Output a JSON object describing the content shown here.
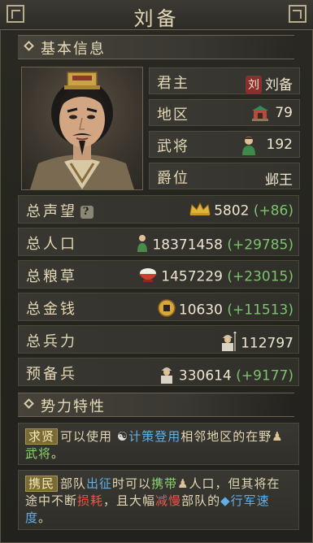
{
  "window": {
    "title": "刘备"
  },
  "basic_info": {
    "section_title": "基本信息",
    "rows": [
      {
        "label": "君主",
        "badge": "刘",
        "value": "刘备"
      },
      {
        "label": "地区",
        "icon": "city-icon",
        "value": "79"
      },
      {
        "label": "武将",
        "icon": "general-icon",
        "value": "192"
      },
      {
        "label": "爵位",
        "value": "邺王"
      }
    ]
  },
  "stats": [
    {
      "label": "总声望",
      "help": "?",
      "icon": "crown-icon",
      "value": "5802",
      "delta": "(+86)"
    },
    {
      "label": "总人口",
      "icon": "population-icon",
      "value": "18371458",
      "delta": "(+29785)"
    },
    {
      "label": "总粮草",
      "icon": "rice-bowl-icon",
      "value": "1457229",
      "delta": "(+23015)"
    },
    {
      "label": "总金钱",
      "icon": "coin-icon",
      "value": "10630",
      "delta": "(+11513)"
    },
    {
      "label": "总兵力",
      "icon": "soldier-icon",
      "value": "112797",
      "delta": ""
    },
    {
      "label": "预备兵",
      "icon": "reserve-soldier-icon",
      "value": "330614",
      "delta": "(+9177)"
    }
  ],
  "traits": {
    "section_title": "势力特性",
    "items": [
      {
        "tag": "求贤",
        "t1": "可以使用",
        "kw1": "计策登用",
        "t2": "相邻地区的在野",
        "kw2": "武将",
        "t3": "。"
      },
      {
        "tag": "携民",
        "t1": "部队",
        "kw1": "出征",
        "t2": "时可以",
        "kw2": "携带",
        "t3": "人口，但其将在途中不断",
        "kw3": "损耗",
        "t4": "，且大幅",
        "kw4": "减慢",
        "t5": "部队的",
        "kw5": "行军速度",
        "t6": "。"
      }
    ]
  },
  "colors": {
    "accent_gold": "#e3d7b4",
    "delta_green": "#7cc36b",
    "keyword_blue": "#5fb0e8",
    "keyword_red": "#e45a4a"
  }
}
